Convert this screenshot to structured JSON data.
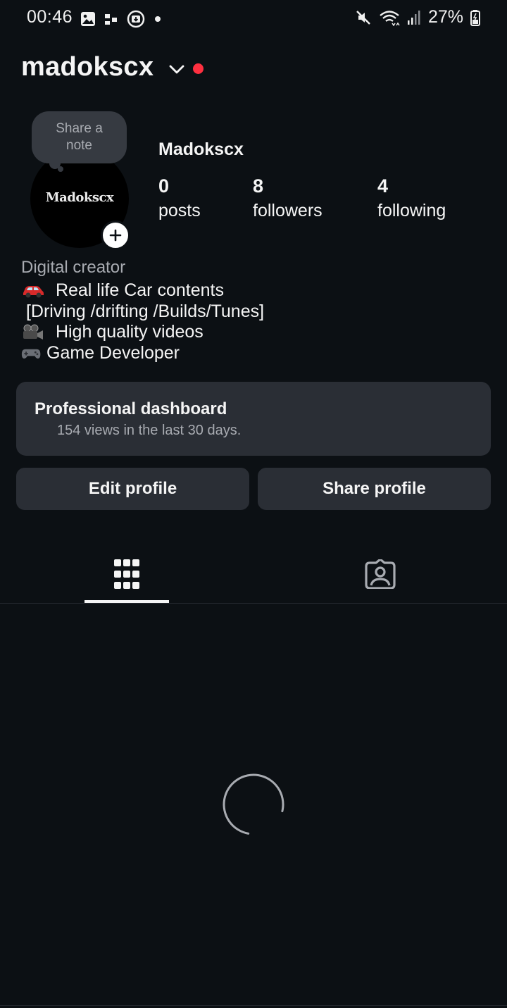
{
  "status_bar": {
    "time": "00:46",
    "battery": "27%",
    "left_icons": [
      "image-icon",
      "dots-icon",
      "download-icon",
      "dot-icon"
    ],
    "right_icons": [
      "mute-icon",
      "wifi-icon",
      "signal-icon",
      "battery-icon"
    ]
  },
  "header": {
    "username": "madokscx",
    "live_dot_color": "#ff3040"
  },
  "profile": {
    "avatar_text": "Madokscx",
    "note": "Share a note",
    "display_name": "Madokscx",
    "stats": [
      {
        "value": "0",
        "label": "posts"
      },
      {
        "value": "8",
        "label": "followers"
      },
      {
        "value": "4",
        "label": "following"
      }
    ]
  },
  "bio": {
    "category": "Digital creator",
    "lines": [
      {
        "icon": "car-icon",
        "text": " Real life Car contents"
      },
      {
        "icon": "",
        "text": " [Driving /drifting /Builds/Tunes]"
      },
      {
        "icon": "camera-icon",
        "text": " High quality videos"
      },
      {
        "icon": "gamepad-icon",
        "text": "Game Developer"
      }
    ]
  },
  "dashboard": {
    "title": "Professional dashboard",
    "subtitle": "154 views in the last 30 days."
  },
  "buttons": {
    "edit": "Edit profile",
    "share": "Share profile"
  },
  "tabs": [
    {
      "icon": "grid-icon",
      "selected": true
    },
    {
      "icon": "tagged-icon",
      "selected": false
    }
  ],
  "colors": {
    "background": "#0c1014",
    "surface": "#2a2e35",
    "muted_text": "#a8abb1",
    "accent_red": "#ff3040"
  }
}
